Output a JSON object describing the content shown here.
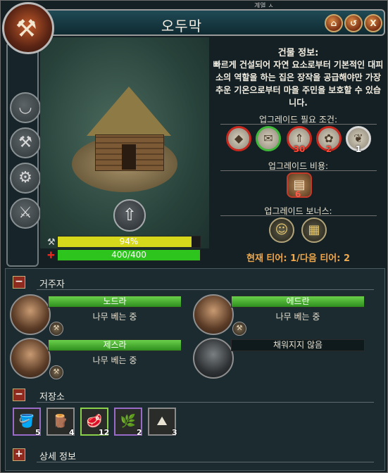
{
  "window": {
    "title": "오두막",
    "top_strip": "계열 ㅅ"
  },
  "header_buttons": [
    {
      "label": "⌂"
    },
    {
      "label": "↺"
    },
    {
      "label": "X"
    }
  ],
  "building": {
    "progress_text": "94%",
    "progress_value": 0.94,
    "health_text": "400/400",
    "health_value": 1.0
  },
  "info": {
    "title": "건물 정보:",
    "description": "빠르게 건설되어 자연 요소로부터 기본적인 대피소의 역할을 하는 집은 장작을 공급해야만 가장 추운 기온으로부터 마을 주민을 보호할 수 있습니다.",
    "requirements_label": "업그레이드 필요 조건:",
    "requirements": [
      {
        "icon": "stone-icon",
        "value": "",
        "color": "#c8281e"
      },
      {
        "icon": "scroll-icon",
        "value": "",
        "color": "#3fb83a"
      },
      {
        "icon": "rank-icon",
        "value": "30",
        "color": "#c8281e"
      },
      {
        "icon": "wheat-icon",
        "value": "2",
        "color": "#c8281e"
      },
      {
        "icon": "herb-icon",
        "value": "1",
        "color": "#d8d8d8"
      }
    ],
    "cost_label": "업그레이드 비용:",
    "cost": {
      "icon": "logs-icon",
      "value": "6"
    },
    "bonus_label": "업그레이드 보너스:",
    "bonuses": [
      {
        "icon": "happiness-icon"
      },
      {
        "icon": "storage-icon"
      }
    ],
    "tier_text": "현재 티어: 1/다음 티어: 2"
  },
  "residents": {
    "label": "거주자",
    "items": [
      {
        "name": "노드라",
        "job": "나무 베는 중",
        "filled": true
      },
      {
        "name": "에드란",
        "job": "나무 베는 중",
        "filled": true
      },
      {
        "name": "제스라",
        "job": "나무 베는 중",
        "filled": true
      },
      {
        "name": "채워지지 않음",
        "job": "",
        "filled": false
      }
    ]
  },
  "storage": {
    "label": "저장소",
    "items": [
      {
        "icon": "water-bucket-icon",
        "count": "5",
        "glyph": "🪣",
        "rarity": "magic"
      },
      {
        "icon": "planks-icon",
        "count": "4",
        "glyph": "🪵",
        "rarity": "normal"
      },
      {
        "icon": "meat-icon",
        "count": "12",
        "glyph": "🥩",
        "rarity": "rare"
      },
      {
        "icon": "herbs-icon",
        "count": "2",
        "glyph": "🌿",
        "rarity": "magic"
      },
      {
        "icon": "ore-icon",
        "count": "3",
        "glyph": "⛰",
        "rarity": "normal"
      }
    ]
  },
  "details": {
    "label": "상세 정보"
  },
  "colors": {
    "progress": "#d6d81c",
    "health": "#2ec41e",
    "resident_bar": "#4cbf34",
    "tier": "#f0a84a"
  }
}
